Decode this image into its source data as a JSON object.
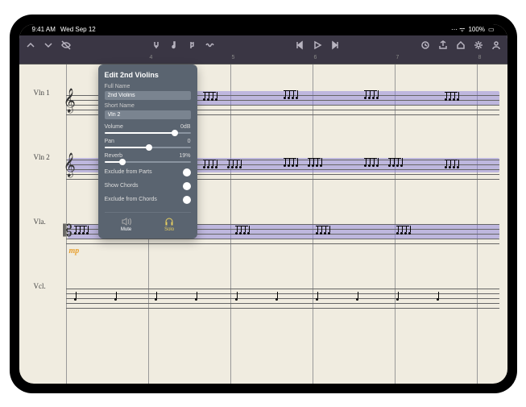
{
  "status": {
    "time": "9:41 AM",
    "date": "Wed Sep 12",
    "wifi": "●●●",
    "battery": "100%"
  },
  "ruler": {
    "marks": [
      "4",
      "5",
      "6",
      "7",
      "8"
    ]
  },
  "instruments": [
    {
      "label": "Vln 1",
      "clef": "𝄞",
      "highlighted": false
    },
    {
      "label": "Vln 2",
      "clef": "𝄞",
      "highlighted": true
    },
    {
      "label": "Vla.",
      "clef": "𝄡",
      "highlighted": true,
      "dynamic": "mp"
    },
    {
      "label": "Vcl.",
      "clef": "",
      "highlighted": false
    }
  ],
  "panel": {
    "title": "Edit 2nd Violins",
    "full_name_label": "Full Name",
    "full_name_value": "2nd Violins",
    "short_name_label": "Short Name",
    "short_name_value": "Vln 2",
    "volume_label": "Volume",
    "volume_value": "0dB",
    "volume_pct": 80,
    "pan_label": "Pan",
    "pan_value": "0",
    "pan_pct": 50,
    "reverb_label": "Reverb",
    "reverb_value": "19%",
    "reverb_pct": 19,
    "exclude_parts_label": "Exclude from Parts",
    "show_chords_label": "Show Chords",
    "exclude_chords_label": "Exclude from Chords",
    "mute_label": "Mute",
    "solo_label": "Solo"
  }
}
